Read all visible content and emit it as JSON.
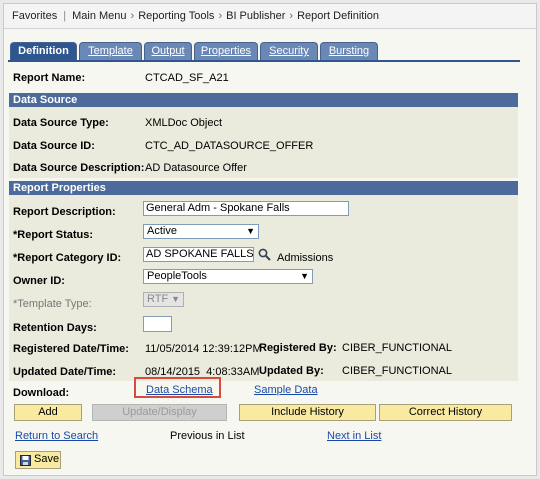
{
  "breadcrumb": {
    "items": [
      "Favorites",
      "Main Menu",
      "Reporting Tools",
      "BI Publisher",
      "Report Definition"
    ]
  },
  "tabs": [
    "Definition",
    "Template",
    "Output",
    "Properties",
    "Security",
    "Bursting"
  ],
  "report_name": {
    "label": "Report Name:",
    "value": "CTCAD_SF_A21"
  },
  "data_source": {
    "header": "Data Source",
    "type_label": "Data Source Type:",
    "type_value": "XMLDoc Object",
    "id_label": "Data Source ID:",
    "id_value": "CTC_AD_DATASOURCE_OFFER",
    "desc_label": "Data Source Description:",
    "desc_value": "AD Datasource Offer"
  },
  "report_properties": {
    "header": "Report Properties",
    "description_label": "Report Description:",
    "description_value": "General Adm - Spokane Falls",
    "status_label": "*Report Status:",
    "status_value": "Active",
    "category_label": "*Report Category ID:",
    "category_value": "AD SPOKANE FALLS",
    "category_desc": "Admissions",
    "owner_label": "Owner ID:",
    "owner_value": "PeopleTools",
    "template_type_label": "*Template Type:",
    "template_type_value": "RTF",
    "retention_label": "Retention Days:",
    "retention_value": "",
    "registered_dt_label": "Registered Date/Time:",
    "registered_dt_value": "11/05/2014 12:39:12PM",
    "registered_by_label": "Registered By:",
    "registered_by_value": "CIBER_FUNCTIONAL",
    "updated_dt_label": "Updated Date/Time:",
    "updated_dt_value": "08/14/2015  4:08:33AM",
    "updated_by_label": "Updated By:",
    "updated_by_value": "CIBER_FUNCTIONAL"
  },
  "download": {
    "label": "Download:",
    "data_schema": "Data Schema",
    "sample_data": "Sample Data"
  },
  "buttons": {
    "add": "Add",
    "update_display": "Update/Display",
    "include_history": "Include History",
    "correct_history": "Correct History"
  },
  "nav": {
    "return_to_search": "Return to Search",
    "previous_in_list": "Previous in List",
    "next_in_list": "Next in List"
  },
  "save": {
    "label": "Save"
  }
}
